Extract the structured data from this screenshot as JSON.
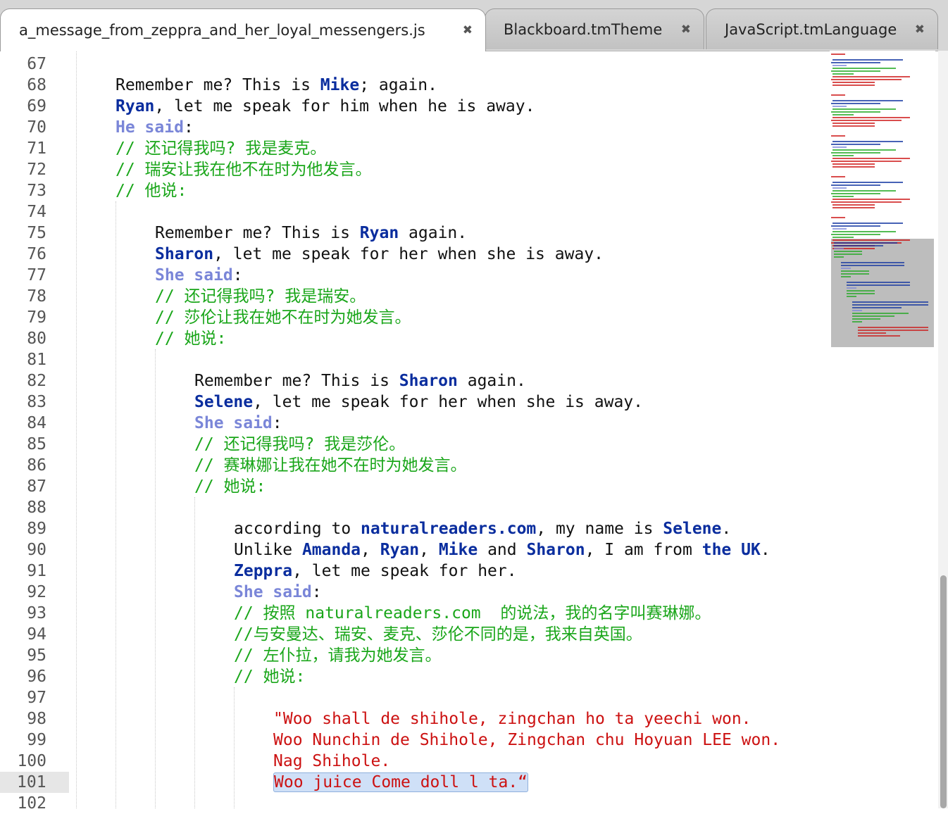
{
  "tabs": [
    {
      "label": "a_message_from_zeppra_and_her_loyal_messengers.js",
      "close": "✖"
    },
    {
      "label": "Blackboard.tmTheme",
      "close": "✖"
    },
    {
      "label": "JavaScript.tmLanguage",
      "close": "✖"
    }
  ],
  "line_numbers": [
    "67",
    "68",
    "69",
    "70",
    "71",
    "72",
    "73",
    "74",
    "75",
    "76",
    "77",
    "78",
    "79",
    "80",
    "81",
    "82",
    "83",
    "84",
    "85",
    "86",
    "87",
    "88",
    "89",
    "90",
    "91",
    "92",
    "93",
    "94",
    "95",
    "96",
    "97",
    "98",
    "99",
    "100",
    "101",
    "102"
  ],
  "current_line": "101",
  "code": {
    "l68": [
      "Remember me? This is ",
      "Mike",
      "; again."
    ],
    "l69": [
      "Ryan",
      ", let me speak for him when he is away."
    ],
    "l70": [
      "He said",
      ":"
    ],
    "l71": "// 还记得我吗? 我是麦克。",
    "l72": "// 瑞安让我在他不在时为他发言。",
    "l73": "// 他说:",
    "l75": [
      "Remember me? This is ",
      "Ryan",
      " again."
    ],
    "l76": [
      "Sharon",
      ", let me speak for her when she is away."
    ],
    "l77": [
      "She said",
      ":"
    ],
    "l78": "// 还记得我吗? 我是瑞安。",
    "l79": "// 莎伦让我在她不在时为她发言。",
    "l80": "// 她说:",
    "l82": [
      "Remember me? This is ",
      "Sharon",
      " again."
    ],
    "l83": [
      "Selene",
      ", let me speak for her when she is away."
    ],
    "l84": [
      "She said",
      ":"
    ],
    "l85": "// 还记得我吗? 我是莎伦。",
    "l86": "// 赛琳娜让我在她不在时为她发言。",
    "l87": "// 她说:",
    "l89": [
      "according to ",
      "naturalreaders.com",
      ", my name is ",
      "Selene",
      "."
    ],
    "l90": [
      "Unlike ",
      "Amanda",
      ", ",
      "Ryan",
      ", ",
      "Mike",
      " and ",
      "Sharon",
      ", I am from ",
      "the UK",
      "."
    ],
    "l91": [
      "Zeppra",
      ", let me speak for her."
    ],
    "l92": [
      "She said",
      ":"
    ],
    "l93": "// 按照 naturalreaders.com  的说法，我的名字叫赛琳娜。",
    "l94": "//与安曼达、瑞安、麦克、莎伦不同的是，我来自英国。",
    "l95": "// 左仆拉，请我为她发言。",
    "l96": "// 她说:",
    "l98": "\"Woo shall de shihole, zingchan ho ta yeechi won.",
    "l99": "Woo Nunchin de Shihole, Zingchan chu Hoyuan LEE won.",
    "l100": "Nag Shihole.",
    "l101": "Woo juice Come doll l ta.“"
  },
  "colors": {
    "keyword": "#0a2d9e",
    "said": "#7a86d8",
    "comment": "#1aa61a",
    "string": "#cc1111",
    "selection": "#cfe0f7"
  }
}
